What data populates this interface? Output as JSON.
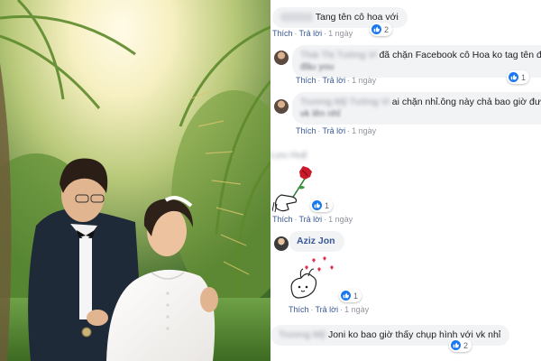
{
  "comments": [
    {
      "author": "",
      "text": "Tang tên cô hoa với",
      "actions": {
        "like": "Thích",
        "reply": "Trả lời",
        "time": "1 ngày"
      },
      "reaction_count": "2"
    },
    {
      "author": "Thái Thị Tường Vi",
      "text": "đã chặn Facebook cô Hoa ko tag tên được",
      "text_blurred": "đâu you",
      "actions": {
        "like": "Thích",
        "reply": "Trả lời",
        "time": "1 ngày"
      },
      "reaction_count": "1"
    },
    {
      "author": "Trương Mỹ Tường Vi",
      "text": "ai chặn nhỉ.ông này chả bao giờ đưa hình",
      "text_blurred": "vk lên nhỉ",
      "actions": {
        "like": "Thích",
        "reply": "Trả lời",
        "time": "1 ngày"
      }
    },
    {
      "author": "Lưu Huệ",
      "sticker": "rose-hand-sticker",
      "actions": {
        "like": "Thích",
        "reply": "Trả lời",
        "time": "1 ngày"
      },
      "reaction_count": "1"
    },
    {
      "author": "Aziz Jon",
      "sticker": "hearts-bunny-sticker",
      "actions": {
        "like": "Thích",
        "reply": "Trả lời",
        "time": "1 ngày"
      },
      "reaction_count": "1"
    },
    {
      "author": "Trương Mỹ",
      "text": "Joni ko bao giờ thấy chụp hình với vk nhỉ",
      "reaction_count": "2"
    }
  ],
  "icons": {
    "like": "thumbs-up-icon",
    "avatar": "profile-avatar"
  },
  "colors": {
    "link": "#385898",
    "bubble": "#f2f3f5",
    "like_blue": "#1877f2"
  }
}
